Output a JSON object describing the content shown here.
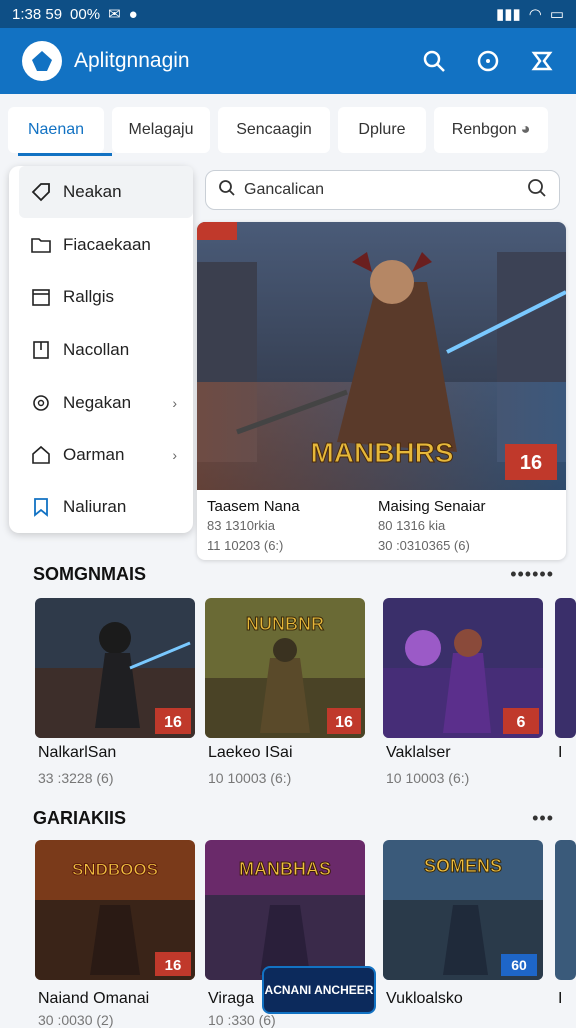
{
  "status_bar": {
    "time": "1:38 59",
    "battery_text": "00%"
  },
  "app_bar": {
    "title": "Aplitgnnagin"
  },
  "tabs": [
    {
      "label": "Naenan",
      "active": true
    },
    {
      "label": "Melagaju"
    },
    {
      "label": "Sencaagin"
    },
    {
      "label": "Dplure"
    },
    {
      "label": "Renbgon"
    }
  ],
  "menu": [
    {
      "label": "Neakan",
      "icon": "tag-icon"
    },
    {
      "label": "Fiacaekaan",
      "icon": "folder-icon"
    },
    {
      "label": "Rallgis",
      "icon": "calendar-icon"
    },
    {
      "label": "Nacollan",
      "icon": "document-icon"
    },
    {
      "label": "Negakan",
      "icon": "settings-icon",
      "chevron": "›"
    },
    {
      "label": "Oarman",
      "icon": "home-icon",
      "chevron": "›"
    },
    {
      "label": "Naliuran",
      "icon": "bookmark-icon"
    }
  ],
  "search": {
    "value": "Gancalican"
  },
  "featured": {
    "banner_title": "MANBHRS",
    "badge": "16",
    "items": [
      {
        "title": "Taasem Nana",
        "subtitle": "83 1310rkia",
        "meta": "11 10203 (6:)"
      },
      {
        "title": "Maising Senaiar",
        "subtitle": "80 1316 kia",
        "meta": "30 :0310365 (6)"
      }
    ]
  },
  "sections": [
    {
      "title": "SOMGNMAIS",
      "more": "••••••",
      "items": [
        {
          "title": "NalkarlSan",
          "meta": "33 :3228 (6)",
          "badge": "16"
        },
        {
          "title": "Laekeo ISai",
          "meta": "10 10003 (6:)",
          "badge": "16"
        },
        {
          "title": "Vaklalser",
          "meta": "10 10003 (6:)",
          "badge": "6"
        },
        {
          "title": "I",
          "meta": ""
        }
      ]
    },
    {
      "title": "GARIAKIIS",
      "more": "•••",
      "items": [
        {
          "title": "Naiand Omanai",
          "meta": "30 :0030 (2)",
          "badge": "16",
          "banner": "SNDBOOS"
        },
        {
          "title": "Viraga",
          "meta": "10 :330 (6)",
          "badge": "",
          "banner": "MANBHAS"
        },
        {
          "title": "Vukloalsko",
          "meta": "",
          "badge": "60",
          "banner": "SOMENS"
        },
        {
          "title": "I",
          "meta": ""
        }
      ]
    }
  ],
  "floating_logo": "ACNANI ANCHEER",
  "colors": {
    "primary": "#1272c3",
    "status": "#0e4f86"
  }
}
